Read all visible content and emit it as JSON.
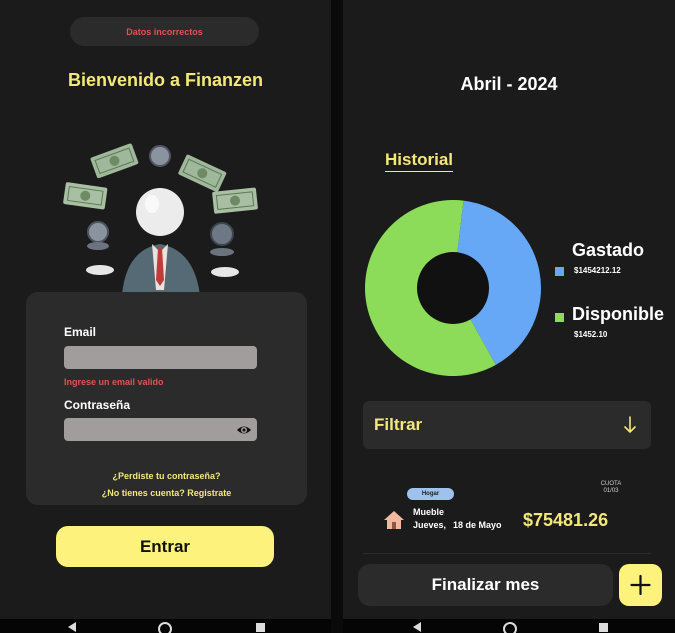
{
  "login": {
    "error_banner": "Datos incorrectos",
    "welcome_title": "Bienvenido a Finanzen",
    "email_label": "Email",
    "email_error": "Ingrese un email valido",
    "password_label": "Contraseña",
    "forgot_link": "¿Perdiste tu contraseña?",
    "register_link": "¿No tienes cuenta? Registrate",
    "enter_button": "Entrar"
  },
  "summary": {
    "month_title": "Abril - 2024",
    "history_title": "Historial",
    "legend": [
      {
        "name": "Gastado",
        "value": "$1454212.12",
        "color": "#66a8f5"
      },
      {
        "name": "Disponible",
        "value": "$1452.10",
        "color": "#8cdc5a"
      }
    ],
    "filter_label": "Filtrar",
    "expense": {
      "tag": "Hogar",
      "name": "Mueble",
      "day": "Jueves,",
      "date": "18 de Mayo",
      "amount": "$75481.26",
      "cuota_label": "CUOTA",
      "cuota_value": "01/03"
    },
    "finish_button": "Finalizar mes"
  },
  "chart_data": {
    "type": "pie",
    "categories": [
      "Gastado",
      "Disponible"
    ],
    "values": [
      1454212.12,
      1452.1
    ],
    "colors": [
      "#66a8f5",
      "#8cdc5a"
    ]
  },
  "colors": {
    "accent_yellow": "#fcf27c",
    "error_red": "#e05252",
    "card_bg": "#2b2b2b",
    "screen_bg": "#1b1b1b"
  },
  "icons": [
    "eye-icon",
    "chevron-down-arrow-icon",
    "home-icon",
    "plus-icon",
    "nav-back-icon",
    "nav-home-icon",
    "nav-recents-icon"
  ]
}
